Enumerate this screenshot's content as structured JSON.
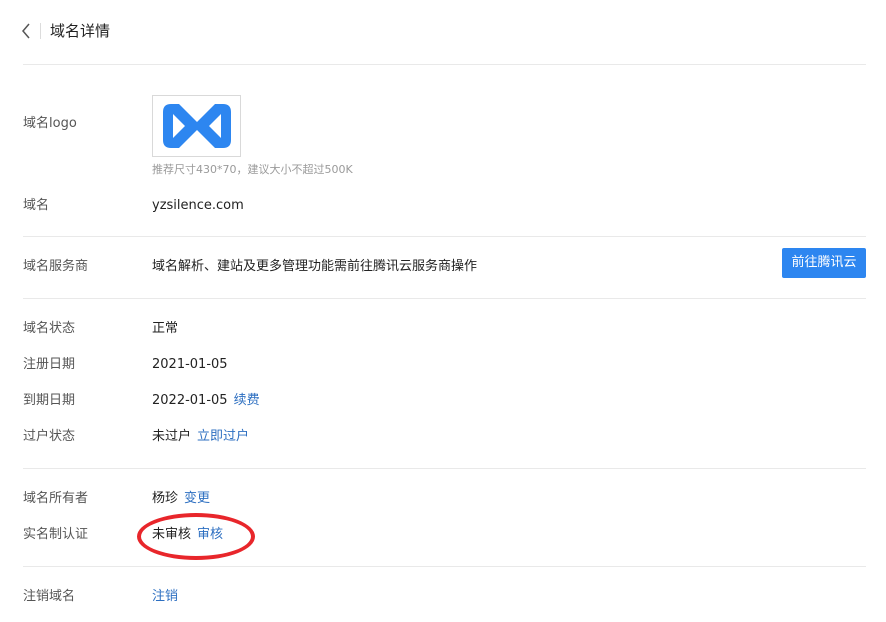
{
  "header": {
    "title": "域名详情",
    "back_icon": "chevron-left-icon"
  },
  "logo": {
    "label": "域名logo",
    "hint": "推荐尺寸430*70，建议大小不超过500K",
    "brand_color": "#2d86f0"
  },
  "domain": {
    "label": "域名",
    "value": "yzsilence.com"
  },
  "provider": {
    "label": "域名服务商",
    "value": "域名解析、建站及更多管理功能需前往腾讯云服务商操作",
    "button": "前往腾讯云"
  },
  "status": {
    "label": "域名状态",
    "value": "正常"
  },
  "register": {
    "label": "注册日期",
    "value": "2021-01-05"
  },
  "expire": {
    "label": "到期日期",
    "value": "2022-01-05",
    "link": "续费"
  },
  "transfer": {
    "label": "过户状态",
    "value": "未过户",
    "link": "立即过户"
  },
  "owner": {
    "label": "域名所有者",
    "value": "杨珍",
    "link": "变更"
  },
  "verify": {
    "label": "实名制认证",
    "value": "未审核",
    "link": "审核",
    "highlight_color": "#e8262b"
  },
  "cancel": {
    "label": "注销域名",
    "link": "注销"
  },
  "colors": {
    "link": "#2d6fc1",
    "primary": "#2d86f0"
  }
}
